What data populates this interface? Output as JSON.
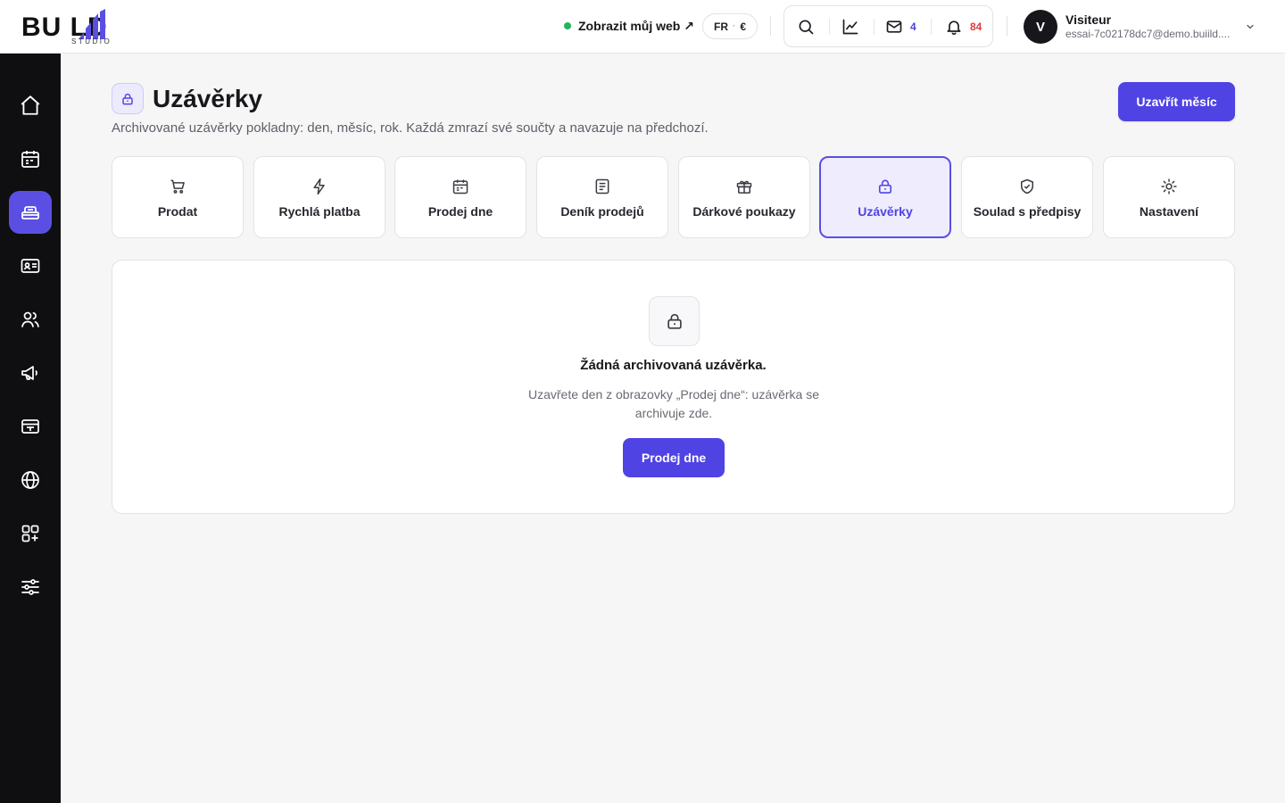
{
  "brand": {
    "logo_text": "BU  LD",
    "logo_sub": "STUDIO",
    "accent": "#4f43e4"
  },
  "header": {
    "view_site": "Zobrazit můj web ↗",
    "lang": "FR",
    "lang_sep": "·",
    "currency": "€",
    "messages_count": "4",
    "notifications_count": "84",
    "user": {
      "initial": "V",
      "name": "Visiteur",
      "email": "essai-7c02178dc7@demo.buiild...."
    }
  },
  "sidebar": {
    "items": [
      {
        "icon": "home-icon"
      },
      {
        "icon": "calendar-icon"
      },
      {
        "icon": "cash-register-icon",
        "active": true
      },
      {
        "icon": "contact-card-icon"
      },
      {
        "icon": "users-icon"
      },
      {
        "icon": "megaphone-icon"
      },
      {
        "icon": "payment-terminal-icon"
      },
      {
        "icon": "globe-icon"
      },
      {
        "icon": "apps-add-icon"
      },
      {
        "icon": "sliders-icon"
      }
    ]
  },
  "page": {
    "title": "Uzávěrky",
    "subtitle": "Archivované uzávěrky pokladny: den, měsíc, rok. Každá zmrazí své součty a navazuje na předchozí.",
    "primary_action": "Uzavřít měsíc"
  },
  "tabs": [
    {
      "label": "Prodat",
      "icon": "cart-icon"
    },
    {
      "label": "Rychlá platba",
      "icon": "lightning-icon"
    },
    {
      "label": "Prodej dne",
      "icon": "calendar-icon"
    },
    {
      "label": "Deník prodejů",
      "icon": "journal-icon"
    },
    {
      "label": "Dárkové poukazy",
      "icon": "gift-icon"
    },
    {
      "label": "Uzávěrky",
      "icon": "lock-icon",
      "active": true
    },
    {
      "label": "Soulad s předpisy",
      "icon": "shield-check-icon"
    },
    {
      "label": "Nastavení",
      "icon": "sun-settings-icon"
    }
  ],
  "empty_state": {
    "icon": "lock-icon",
    "title": "Žádná archivovaná uzávěrka.",
    "text": "Uzavřete den z obrazovky „Prodej dne“: uzávěrka se archivuje zde.",
    "button": "Prodej dne"
  }
}
